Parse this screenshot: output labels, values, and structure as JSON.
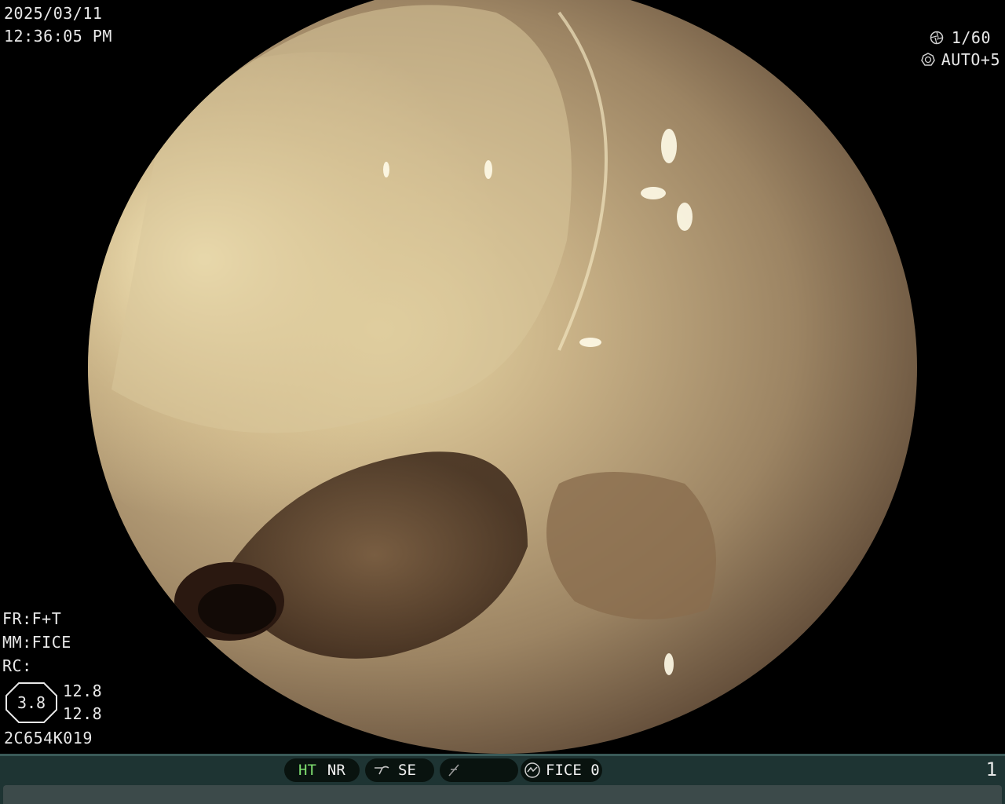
{
  "header": {
    "date": "2025/03/11",
    "time": "12:36:05  PM"
  },
  "exposure": {
    "shutter_icon": "aperture-icon",
    "shutter": "1/60",
    "iris_icon": "iris-icon",
    "iris": "AUTO+5"
  },
  "status": {
    "fr": "FR:F+T",
    "mm": "MM:FICE",
    "rc": "RC:",
    "badge": "3.8",
    "value1": "12.8",
    "value2": "12.8",
    "serial": "2C654K019"
  },
  "bottom_bar": {
    "ht": "HT",
    "nr": "NR",
    "se_icon": "enhance-icon",
    "se": "SE",
    "f_icon": "slash-icon",
    "fice_icon": "fice-icon",
    "fice": "FICE 0",
    "page": "1",
    "colors": {
      "ht": "#7fe070",
      "bar": "#1e3433",
      "pill": "#09130f"
    }
  }
}
